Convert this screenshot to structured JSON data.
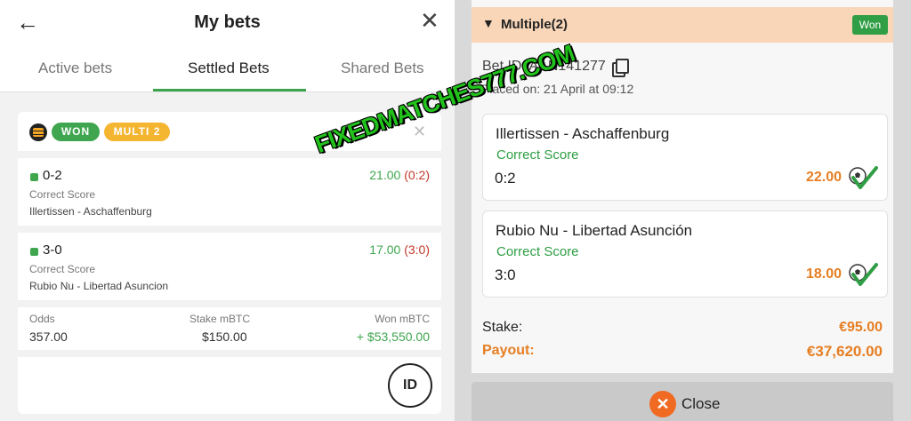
{
  "left": {
    "title": "My bets",
    "back_icon": "←",
    "close_icon": "✕",
    "tabs": [
      {
        "label": "Active bets"
      },
      {
        "label": "Settled Bets"
      },
      {
        "label": "Shared Bets"
      }
    ],
    "card": {
      "status": "WON",
      "type": "MULTI 2",
      "selections": [
        {
          "score": "0-2",
          "odds": "21.00",
          "result": "(0:2)",
          "market": "Correct Score",
          "match": "Illertissen - Aschaffenburg"
        },
        {
          "score": "3-0",
          "odds": "17.00",
          "result": "(3:0)",
          "market": "Correct Score",
          "match": "Rubio Nu - Libertad Asuncion"
        }
      ],
      "summary": {
        "odds_label": "Odds",
        "odds_value": "357.00",
        "stake_label": "Stake mBTC",
        "stake_value": "$150.00",
        "won_label": "Won mBTC",
        "won_value": "+ $53,550.00"
      },
      "id_button": "ID"
    }
  },
  "watermark": "FIXEDMATCHES777.COM",
  "right": {
    "header_title": "Multiple(2)",
    "status_badge": "Won",
    "bet_id": "Bet ID: AAN141277",
    "placed_on": "Placed on: 21 April at 09:12",
    "selections": [
      {
        "match": "Illertissen - Aschaffenburg",
        "market": "Correct Score",
        "score": "0:2",
        "odds": "22.00"
      },
      {
        "match": "Rubio Nu - Libertad Asunción",
        "market": "Correct Score",
        "score": "3:0",
        "odds": "18.00"
      }
    ],
    "stake_label": "Stake:",
    "stake_value": "€95.00",
    "payout_label": "Payout:",
    "payout_value": "€37,620.00",
    "close_label": "Close"
  },
  "colors": {
    "green": "#3fa64f",
    "orange": "#e67e22",
    "header_peach": "#f9d6b8",
    "won_badge": "#2f9e44",
    "multi_badge": "#f4b531"
  }
}
